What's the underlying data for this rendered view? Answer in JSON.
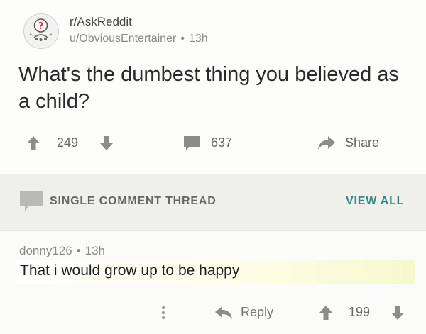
{
  "post": {
    "subreddit": "r/AskReddit",
    "author": "u/ObviousEntertainer",
    "separator": "•",
    "age": "13h",
    "title": "What's the dumbest thing you believed as a child?",
    "score": "249",
    "comment_count": "637",
    "share_label": "Share"
  },
  "thread": {
    "label": "SINGLE COMMENT THREAD",
    "view_all": "VIEW ALL"
  },
  "comment": {
    "author": "donny126",
    "separator": "•",
    "age": "13h",
    "body": "That i would grow up to be happy",
    "reply_label": "Reply",
    "score": "199"
  },
  "colors": {
    "accent": "#2f8b84",
    "highlight": "#f8f8cf",
    "icon_gray": "#8c8c8c"
  },
  "icons": [
    "subreddit-avatar-icon",
    "upvote-icon",
    "downvote-icon",
    "comment-icon",
    "share-icon",
    "more-icon",
    "reply-icon"
  ]
}
